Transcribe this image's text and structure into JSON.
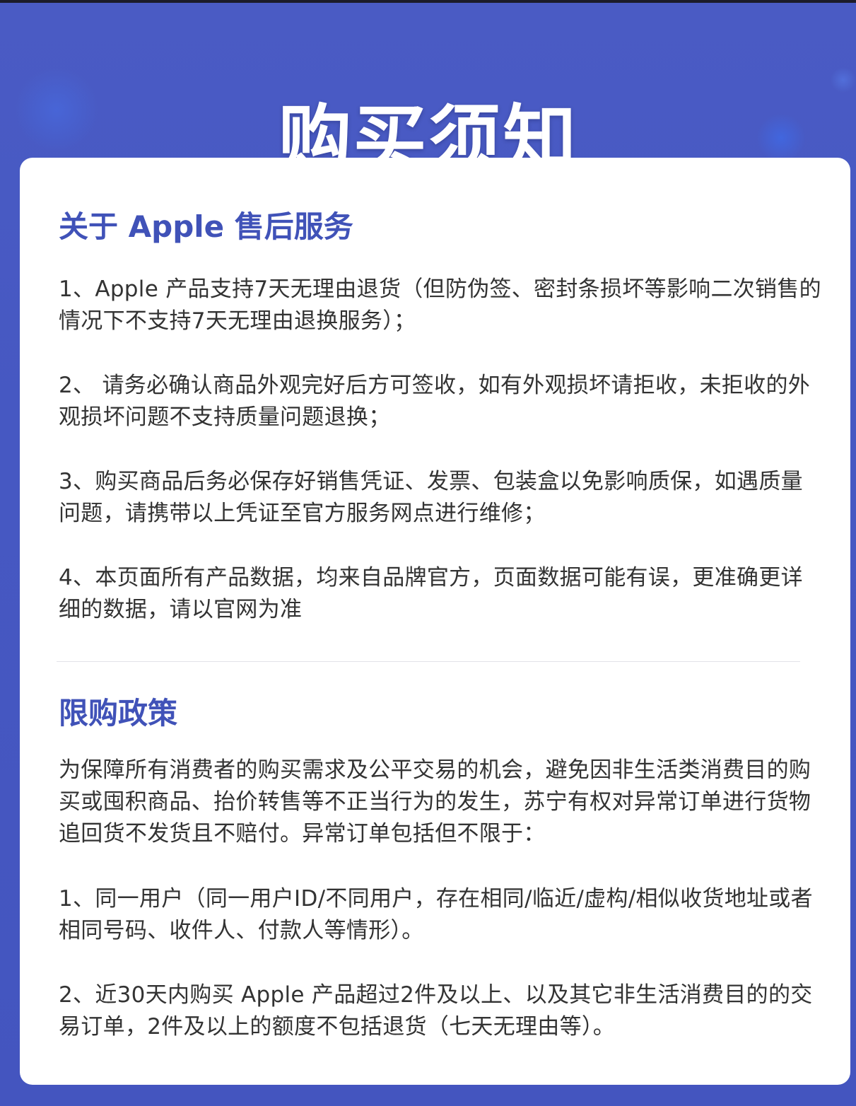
{
  "header": {
    "title": "购买须知"
  },
  "section_after_sales": {
    "title": "关于 Apple 售后服务",
    "items": [
      "1、Apple 产品支持7天无理由退货（但防伪签、密封条损坏等影响二次销售的情况下不支持7天无理由退换服务）；",
      "2、 请务必确认商品外观完好后方可签收，如有外观损坏请拒收，未拒收的外观损坏问题不支持质量问题退换；",
      "3、购买商品后务必保存好销售凭证、发票、包装盒以免影响质保，如遇质量问题，请携带以上凭证至官方服务网点进行维修；",
      "4、本页面所有产品数据，均来自品牌官方，页面数据可能有误，更准确更详细的数据，请以官网为准"
    ]
  },
  "section_purchase_limit": {
    "title": "限购政策",
    "intro": "为保障所有消费者的购买需求及公平交易的机会，避免因非生活类消费目的购买或囤积商品、抬价转售等不正当行为的发生，苏宁有权对异常订单进行货物追回货不发货且不赔付。异常订单包括但不限于：",
    "items": [
      "1、同一用户（同一用户ID/不同用户，存在相同/临近/虚构/相似收货地址或者相同号码、收件人、付款人等情形）。",
      "2、近30天内购买 Apple 产品超过2件及以上、以及其它非生活消费目的的交易订单，2件及以上的额度不包括退货（七天无理由等）。"
    ]
  },
  "colors": {
    "background": "#4a5bc4",
    "section_title": "#4052b8",
    "body_text": "#333333",
    "card": "#ffffff"
  }
}
